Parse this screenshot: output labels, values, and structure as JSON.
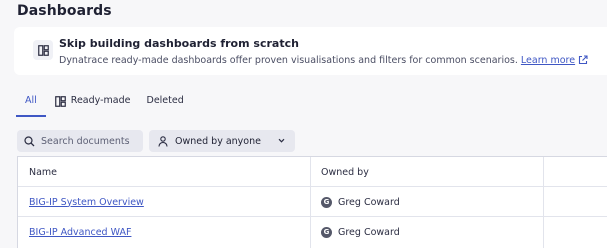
{
  "page": {
    "title": "Dashboards"
  },
  "banner": {
    "heading": "Skip building dashboards from scratch",
    "text": "Dynatrace ready-made dashboards offer proven visualisations and filters for common scenarios.",
    "link_label": "Learn more"
  },
  "tabs": [
    {
      "label": "All",
      "active": true
    },
    {
      "label": "Ready-made",
      "active": false
    },
    {
      "label": "Deleted",
      "active": false
    }
  ],
  "filters": {
    "search_placeholder": "Search documents",
    "owner_selected": "Owned by anyone"
  },
  "table": {
    "columns": [
      "Name",
      "Owned by"
    ],
    "rows": [
      {
        "name": "BIG-IP System Overview",
        "owner": "Greg Coward",
        "owner_initial": "G"
      },
      {
        "name": "BIG-IP Advanced WAF",
        "owner": "Greg Coward",
        "owner_initial": "G"
      }
    ]
  },
  "colors": {
    "accent": "#3f57c4",
    "background": "#f7f7f9",
    "avatar": "#555869"
  }
}
